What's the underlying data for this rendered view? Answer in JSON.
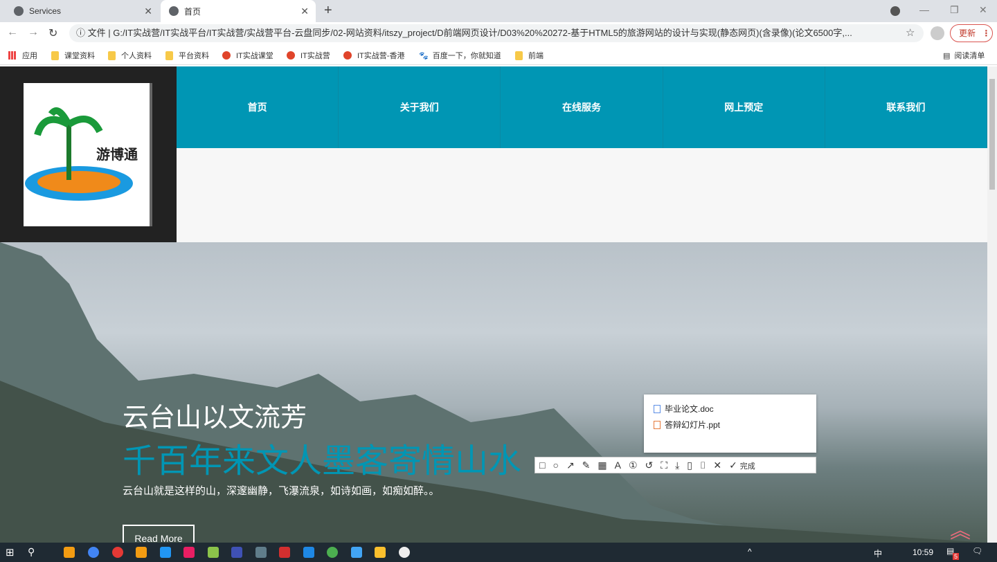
{
  "browser": {
    "tabs": [
      {
        "label": "Services",
        "active": false
      },
      {
        "label": "首页",
        "active": true
      }
    ],
    "url_prefix": "文件",
    "url": "G:/IT实战营/IT实战平台/IT实战营/实战营平台-云盘同步/02-网站资料/itszy_project/D前端网页设计/D03%20%20272-基于HTML5的旅游网站的设计与实现(静态网页)(含录像)(论文6500字,...",
    "update_label": "更新",
    "bookmarks": [
      {
        "label": "应用",
        "icon": "apps-icon"
      },
      {
        "label": "课堂资料",
        "icon": "folder-icon"
      },
      {
        "label": "个人资料",
        "icon": "folder-icon"
      },
      {
        "label": "平台资料",
        "icon": "folder-icon"
      },
      {
        "label": "IT实战课堂",
        "icon": "chrome-icon"
      },
      {
        "label": "IT实战营",
        "icon": "chrome-icon"
      },
      {
        "label": "IT实战营-香港",
        "icon": "chrome-icon"
      },
      {
        "label": "百度一下，你就知道",
        "icon": "baidu-icon"
      },
      {
        "label": "前端",
        "icon": "folder-icon"
      }
    ],
    "reading_list": "阅读清单"
  },
  "site": {
    "logo_text": "游博通",
    "nav": [
      "首页",
      "关于我们",
      "在线服务",
      "网上预定",
      "联系我们"
    ],
    "hero": {
      "title": "云台山以文流芳",
      "subtitle": "千百年来文人墨客寄情山水",
      "desc": "云台山就是这样的山，深邃幽静，飞瀑流泉，如诗如画，如痴如醉。。",
      "button": "Read More"
    },
    "accent": "#0096b4"
  },
  "popup": {
    "files": [
      "毕业论文.doc",
      "答辩幻灯片.ppt"
    ]
  },
  "snip_toolbar": {
    "done": "完成"
  },
  "taskbar": {
    "ime": "中",
    "time": "10:59",
    "notif_count": "5"
  }
}
